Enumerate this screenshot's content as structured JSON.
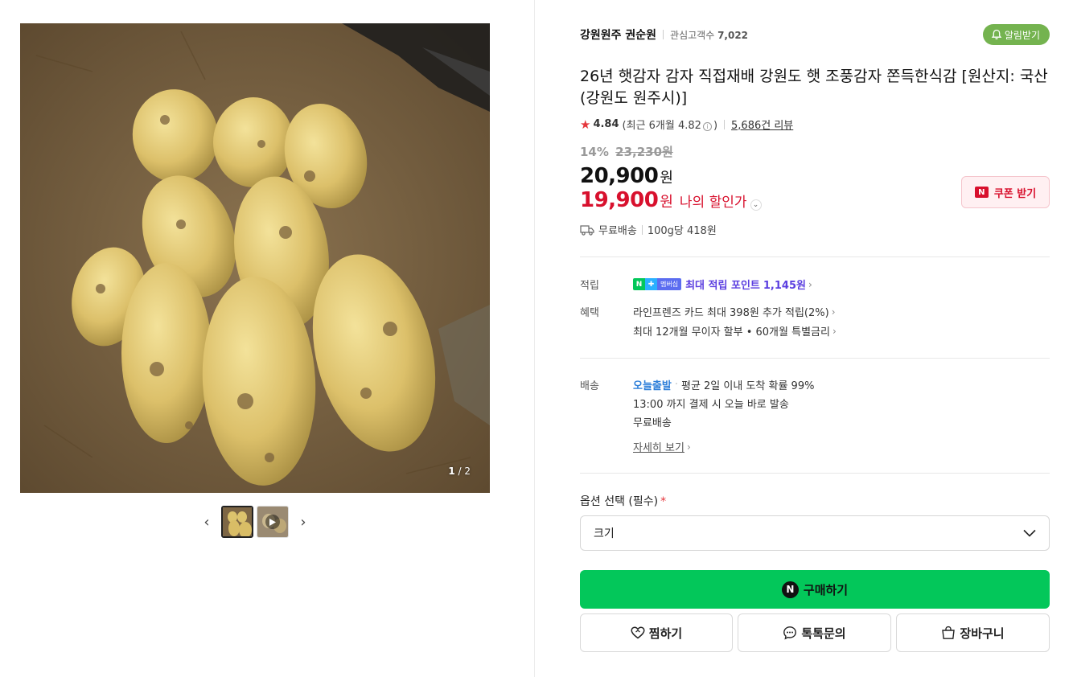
{
  "gallery": {
    "counter_current": "1",
    "counter_total": "/ 2",
    "prev_icon": "chevron-left-icon",
    "next_icon": "chevron-right-icon",
    "thumbnails": [
      {
        "name": "potato-thumbnail",
        "active": true
      },
      {
        "name": "video-thumbnail",
        "active": false,
        "icon": "play-icon"
      }
    ]
  },
  "store": {
    "name": "강원원주 권순원",
    "interest_label": "관심고객수",
    "interest_count": "7,022",
    "alarm_label": "알림받기",
    "alarm_icon": "bell-plus-icon"
  },
  "product": {
    "title": "26년 햇감자 감자 직접재배 강원도 햇 조풍감자 쫀득한식감 [원산지: 국산(강원도 원주시)]",
    "rating": "4.84",
    "rating_recent_prefix": "(최근 6개월 4.82",
    "rating_recent_suffix": ")",
    "review_count": "5,686건 리뷰",
    "discount_rate": "14%",
    "original_price": "23,230원",
    "price": "20,900",
    "price_unit": "원",
    "my_price": "19,900",
    "my_price_unit": "원",
    "my_price_label": "나의 할인가",
    "coupon_label": "쿠폰 받기",
    "shipping_free": "무료배송",
    "unit_price": "100g당 418원"
  },
  "benefits": {
    "points_label": "적립",
    "npay_badge": "N",
    "npay_membership": "멤버십",
    "points_text": "최대 적립 포인트",
    "points_value": "1,145원",
    "benefit_label": "혜택",
    "card_benefit": "라인프렌즈 카드 최대 398원 추가 적립(2%)",
    "installment": "최대 12개월 무이자 할부 • 60개월 특별금리"
  },
  "delivery": {
    "label": "배송",
    "today": "오늘출발",
    "arrival": "평균 2일 이내 도착 확률 99%",
    "cutoff": "13:00 까지 결제 시 오늘 바로 발송",
    "free": "무료배송",
    "detail": "자세히 보기"
  },
  "options": {
    "label": "옵션 선택 (필수)",
    "required_mark": "*",
    "select_value": "크기"
  },
  "actions": {
    "buy": "구매하기",
    "buy_badge": "N",
    "wish": "찜하기",
    "talk": "톡톡문의",
    "cart": "장바구니"
  },
  "colors": {
    "green": "#03c75a",
    "red": "#d8102d",
    "alarm_green": "#74b34f",
    "point_purple": "#5b3fe0",
    "today_blue": "#2e7fd9"
  }
}
